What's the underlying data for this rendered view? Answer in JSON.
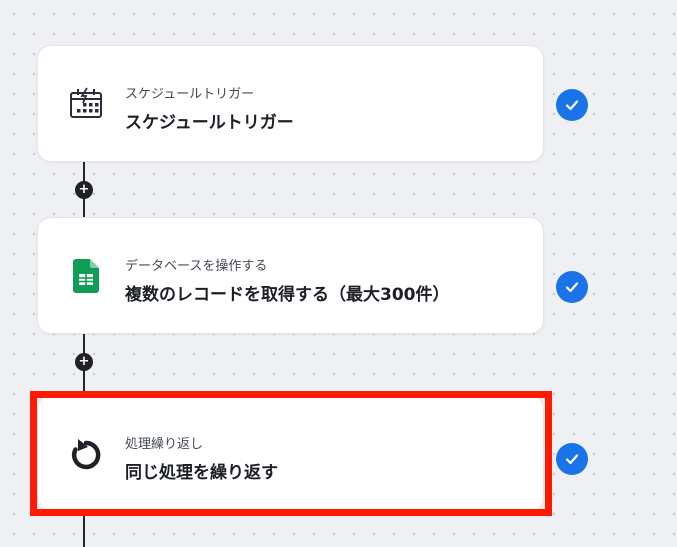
{
  "flow": {
    "steps": [
      {
        "category": "スケジュールトリガー",
        "title": "スケジュールトリガー",
        "icon": "calendar-bolt-icon",
        "status": "completed"
      },
      {
        "category": "データベースを操作する",
        "title": "複数のレコードを取得する（最大300件）",
        "icon": "google-sheets-icon",
        "status": "completed"
      },
      {
        "category": "処理繰り返し",
        "title": "同じ処理を繰り返す",
        "icon": "loop-icon",
        "status": "completed",
        "highlighted": true
      }
    ],
    "add_button_label": "+"
  },
  "colors": {
    "background": "#eef0f4",
    "check_badge": "#1a73e8",
    "highlight_border": "#ff1a00",
    "sheets_green": "#0f9d58"
  }
}
